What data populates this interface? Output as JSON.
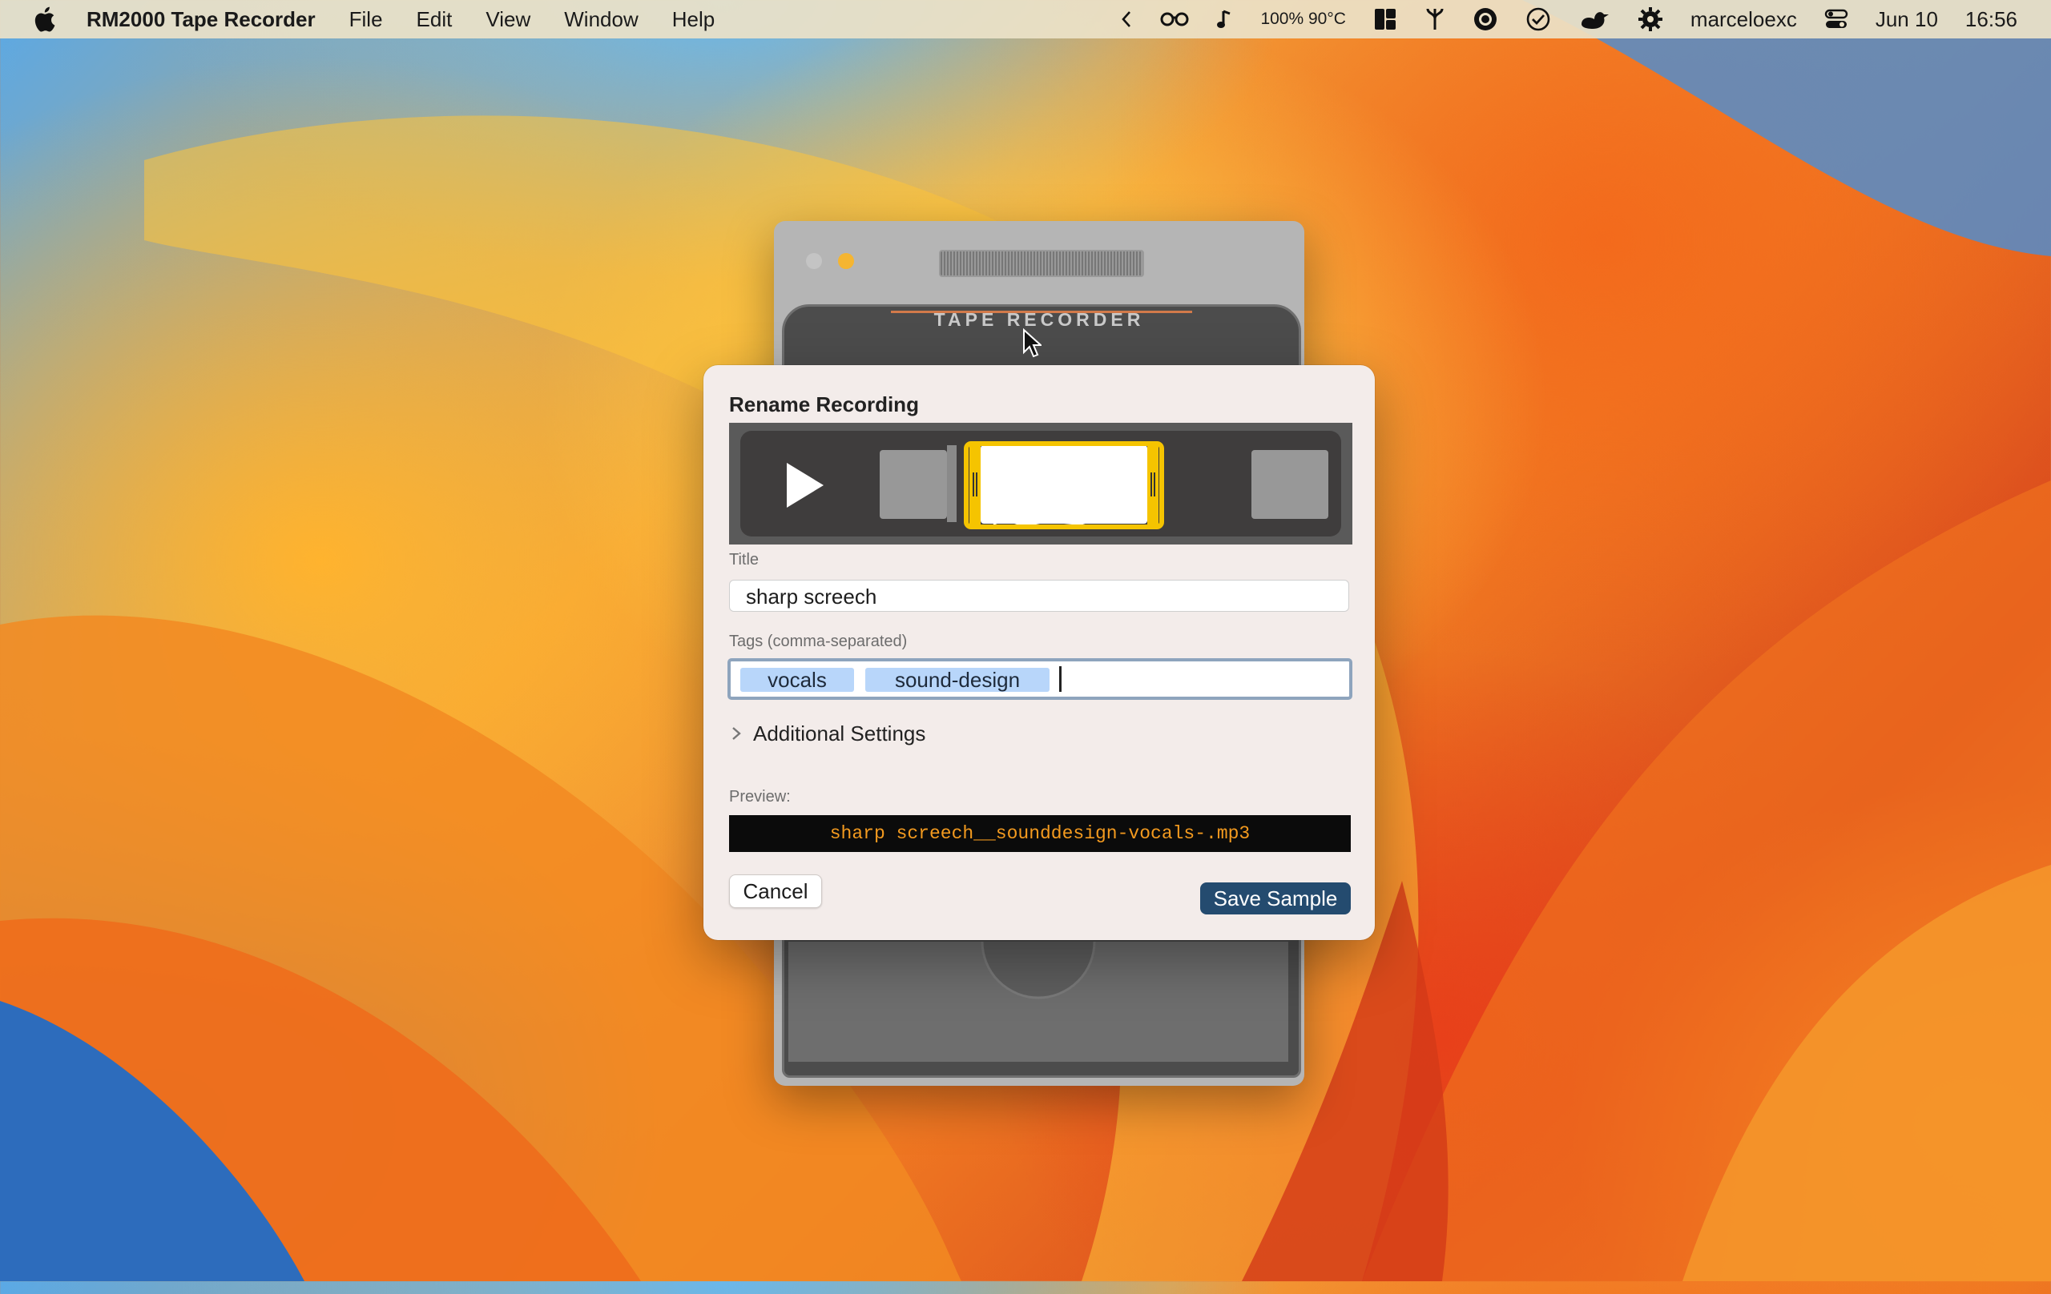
{
  "menubar": {
    "app_name": "RM2000 Tape Recorder",
    "menus": [
      "File",
      "Edit",
      "View",
      "Window",
      "Help"
    ],
    "status_text": "100% 90°C",
    "username": "marceloexc",
    "date": "Jun 10",
    "time": "16:56"
  },
  "back_window": {
    "brand": "TAPE RECORDER"
  },
  "dialog": {
    "title": "Rename Recording",
    "title_label": "Title",
    "title_value": "sharp screech",
    "tags_label": "Tags (comma-separated)",
    "tags": [
      "vocals",
      "sound-design"
    ],
    "additional_settings": "Additional Settings",
    "preview_label": "Preview:",
    "preview_value": "sharp screech__sounddesign-vocals-.mp3",
    "cancel": "Cancel",
    "save": "Save Sample"
  },
  "colors": {
    "accent_yellow": "#f5c400",
    "save_button": "#244b6f",
    "preview_text": "#f39a1f",
    "tag_bg": "#b8d6fa"
  },
  "icons": [
    "apple-icon",
    "chevron-left-icon",
    "glasses-icon",
    "music-note-icon",
    "layout-icon",
    "fork-icon",
    "record-icon",
    "checkmark-icon",
    "duck-icon",
    "gear-icon",
    "control-center-icon",
    "play-icon",
    "chevron-right-icon",
    "cursor-icon"
  ]
}
